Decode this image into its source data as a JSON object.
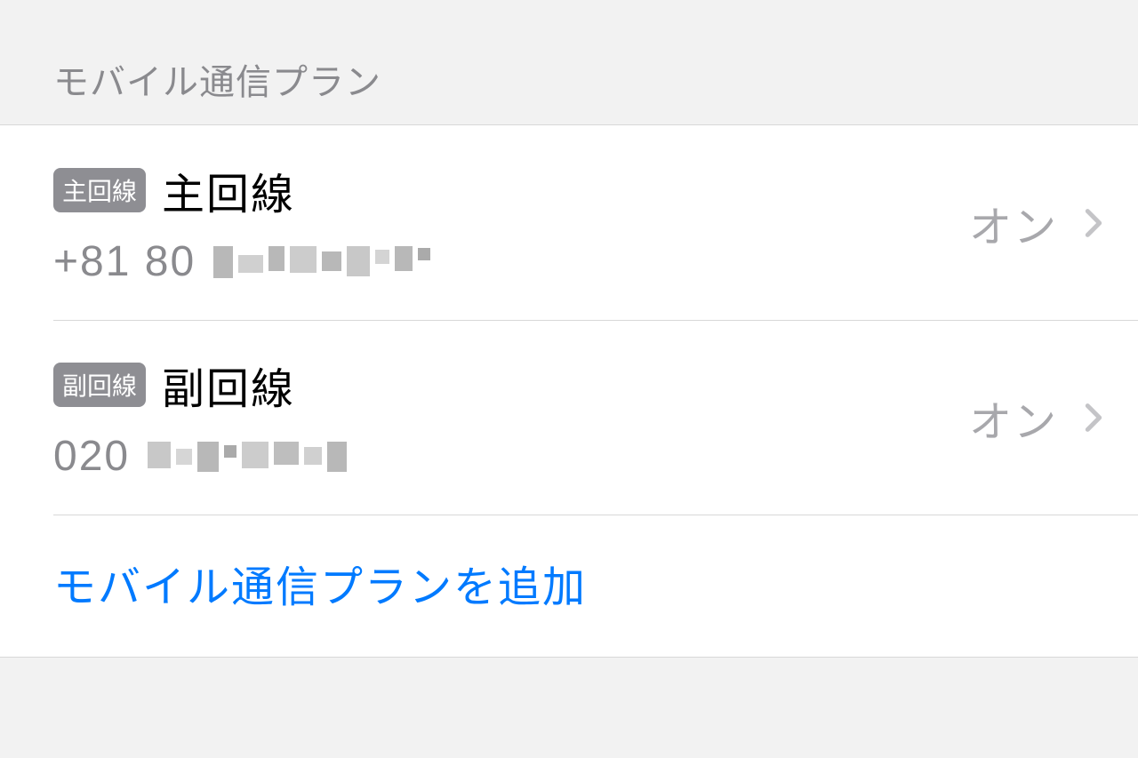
{
  "section_header": "モバイル通信プラン",
  "lines": [
    {
      "badge": "主回線",
      "name": "主回線",
      "phone_prefix": "+81 80",
      "status": "オン"
    },
    {
      "badge": "副回線",
      "name": "副回線",
      "phone_prefix": "020",
      "status": "オン"
    }
  ],
  "add_plan_label": "モバイル通信プランを追加"
}
